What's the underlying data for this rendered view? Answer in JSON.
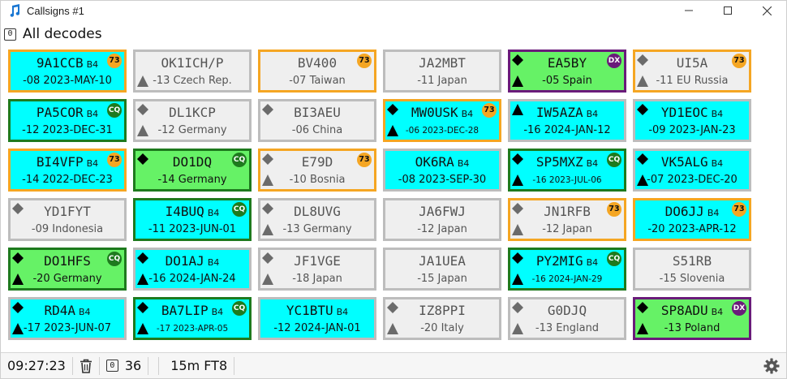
{
  "window": {
    "title": "Callsigns #1"
  },
  "header": {
    "badge": "0",
    "title": "All decodes"
  },
  "colors": {
    "cyan": "#00ffff",
    "green": "#66f266",
    "gray": "#efefef",
    "orange": "#f5a623",
    "cq_green": "#1e7a1e",
    "dx_purple": "#6a1b7a"
  },
  "cards": [
    {
      "call": "9A1CCB",
      "b4": "B4",
      "info": "-08 2023-MAY-10",
      "bg": "cyan",
      "border": "orange",
      "badge": "73",
      "diamond": "",
      "triangle": ""
    },
    {
      "call": "OK1ICH/P",
      "b4": "",
      "info": "-13 Czech Rep.",
      "bg": "gray",
      "border": "gray",
      "badge": "",
      "diamond": "",
      "triangle": "gray"
    },
    {
      "call": "BV400",
      "b4": "",
      "info": "-07 Taiwan",
      "bg": "gray",
      "border": "orange",
      "badge": "73",
      "diamond": "",
      "triangle": ""
    },
    {
      "call": "JA2MBT",
      "b4": "",
      "info": "-11 Japan",
      "bg": "gray",
      "border": "gray",
      "badge": "",
      "diamond": "",
      "triangle": ""
    },
    {
      "call": "EA5BY",
      "b4": "",
      "info": "-05 Spain",
      "bg": "green",
      "border": "purple",
      "badge": "DX",
      "diamond": "black",
      "triangle": "black"
    },
    {
      "call": "UI5A",
      "b4": "",
      "info": "-11 EU Russia",
      "bg": "gray",
      "border": "orange",
      "badge": "73",
      "diamond": "gray",
      "triangle": "gray"
    },
    {
      "call": "PA5COR",
      "b4": "B4",
      "info": "-12 2023-DEC-31",
      "bg": "cyan",
      "border": "green",
      "badge": "CQ",
      "diamond": "",
      "triangle": ""
    },
    {
      "call": "DL1KCP",
      "b4": "",
      "info": "-12 Germany",
      "bg": "gray",
      "border": "gray",
      "badge": "",
      "diamond": "gray",
      "triangle": "gray"
    },
    {
      "call": "BI3AEU",
      "b4": "",
      "info": "-06 China",
      "bg": "gray",
      "border": "gray",
      "badge": "",
      "diamond": "gray",
      "triangle": ""
    },
    {
      "call": "MW0USK",
      "b4": "B4",
      "info": "-06 2023-DEC-28",
      "small": true,
      "bg": "cyan",
      "border": "orange",
      "badge": "73",
      "diamond": "black",
      "triangle": "black"
    },
    {
      "call": "IW5AZA",
      "b4": "B4",
      "info": "-16 2024-JAN-12",
      "bg": "cyan",
      "border": "gray",
      "badge": "",
      "diamond": "",
      "triangle": "black-top"
    },
    {
      "call": "YD1EOC",
      "b4": "B4",
      "info": "-09 2023-JAN-23",
      "bg": "cyan",
      "border": "gray",
      "badge": "",
      "diamond": "black",
      "triangle": ""
    },
    {
      "call": "BI4VFP",
      "b4": "B4",
      "info": "-14 2022-DEC-23",
      "bg": "cyan",
      "border": "orange",
      "badge": "73",
      "diamond": "",
      "triangle": ""
    },
    {
      "call": "DO1DQ",
      "b4": "",
      "info": "-14 Germany",
      "bg": "green",
      "border": "green",
      "badge": "CQ",
      "diamond": "black",
      "triangle": ""
    },
    {
      "call": "E79D",
      "b4": "",
      "info": "-10 Bosnia",
      "bg": "gray",
      "border": "orange",
      "badge": "73",
      "diamond": "gray",
      "triangle": "gray"
    },
    {
      "call": "OK6RA",
      "b4": "B4",
      "info": "-08 2023-SEP-30",
      "bg": "cyan",
      "border": "gray",
      "badge": "",
      "diamond": "",
      "triangle": ""
    },
    {
      "call": "SP5MXZ",
      "b4": "B4",
      "info": "-16 2023-JUL-06",
      "small": true,
      "bg": "cyan",
      "border": "green",
      "badge": "CQ",
      "diamond": "black",
      "triangle": "black"
    },
    {
      "call": "VK5ALG",
      "b4": "B4",
      "info": "-07 2023-DEC-20",
      "bg": "cyan",
      "border": "gray",
      "badge": "",
      "diamond": "black",
      "triangle": "black"
    },
    {
      "call": "YD1FYT",
      "b4": "",
      "info": "-09 Indonesia",
      "bg": "gray",
      "border": "gray",
      "badge": "",
      "diamond": "gray",
      "triangle": ""
    },
    {
      "call": "I4BUQ",
      "b4": "B4",
      "info": "-11 2023-JUN-01",
      "bg": "cyan",
      "border": "green",
      "badge": "CQ",
      "diamond": "",
      "triangle": ""
    },
    {
      "call": "DL8UVG",
      "b4": "",
      "info": "-13 Germany",
      "bg": "gray",
      "border": "gray",
      "badge": "",
      "diamond": "gray",
      "triangle": "gray"
    },
    {
      "call": "JA6FWJ",
      "b4": "",
      "info": "-12 Japan",
      "bg": "gray",
      "border": "gray",
      "badge": "",
      "diamond": "",
      "triangle": ""
    },
    {
      "call": "JN1RFB",
      "b4": "",
      "info": "-12 Japan",
      "bg": "gray",
      "border": "orange",
      "badge": "73",
      "diamond": "gray",
      "triangle": "gray"
    },
    {
      "call": "DO6JJ",
      "b4": "B4",
      "info": "-20 2023-APR-12",
      "bg": "cyan",
      "border": "orange",
      "badge": "73",
      "diamond": "",
      "triangle": ""
    },
    {
      "call": "DO1HFS",
      "b4": "",
      "info": "-20 Germany",
      "bg": "green",
      "border": "green",
      "badge": "CQ",
      "diamond": "black",
      "triangle": "black"
    },
    {
      "call": "DO1AJ",
      "b4": "B4",
      "info": "-16 2024-JAN-24",
      "bg": "cyan",
      "border": "gray",
      "badge": "",
      "diamond": "black",
      "triangle": "black"
    },
    {
      "call": "JF1VGE",
      "b4": "",
      "info": "-18 Japan",
      "bg": "gray",
      "border": "gray",
      "badge": "",
      "diamond": "gray",
      "triangle": "gray"
    },
    {
      "call": "JA1UEA",
      "b4": "",
      "info": "-15 Japan",
      "bg": "gray",
      "border": "gray",
      "badge": "",
      "diamond": "",
      "triangle": ""
    },
    {
      "call": "PY2MIG",
      "b4": "B4",
      "info": "-16 2024-JAN-29",
      "small": true,
      "bg": "cyan",
      "border": "green",
      "badge": "CQ",
      "diamond": "black",
      "triangle": "black"
    },
    {
      "call": "S51RB",
      "b4": "",
      "info": "-15 Slovenia",
      "bg": "gray",
      "border": "gray",
      "badge": "",
      "diamond": "",
      "triangle": ""
    },
    {
      "call": "RD4A",
      "b4": "B4",
      "info": "-17 2023-JUN-07",
      "bg": "cyan",
      "border": "gray",
      "badge": "",
      "diamond": "black",
      "triangle": "black"
    },
    {
      "call": "BA7LIP",
      "b4": "B4",
      "info": "-17 2023-APR-05",
      "small": true,
      "bg": "cyan",
      "border": "green",
      "badge": "CQ",
      "diamond": "black",
      "triangle": "black"
    },
    {
      "call": "YC1BTU",
      "b4": "B4",
      "info": "-12 2024-JAN-01",
      "bg": "cyan",
      "border": "gray",
      "badge": "",
      "diamond": "",
      "triangle": ""
    },
    {
      "call": "IZ8PPI",
      "b4": "",
      "info": "-20 Italy",
      "bg": "gray",
      "border": "gray",
      "badge": "",
      "diamond": "gray",
      "triangle": "gray"
    },
    {
      "call": "G0DJQ",
      "b4": "",
      "info": "-13 England",
      "bg": "gray",
      "border": "gray",
      "badge": "",
      "diamond": "gray",
      "triangle": "gray"
    },
    {
      "call": "SP8ADU",
      "b4": "B4",
      "info": "-13 Poland",
      "bg": "green",
      "border": "purple",
      "badge": "DX",
      "diamond": "black",
      "triangle": "black"
    }
  ],
  "status": {
    "time": "09:27:23",
    "zero_badge": "0",
    "count": "36",
    "band_mode": "15m FT8"
  }
}
